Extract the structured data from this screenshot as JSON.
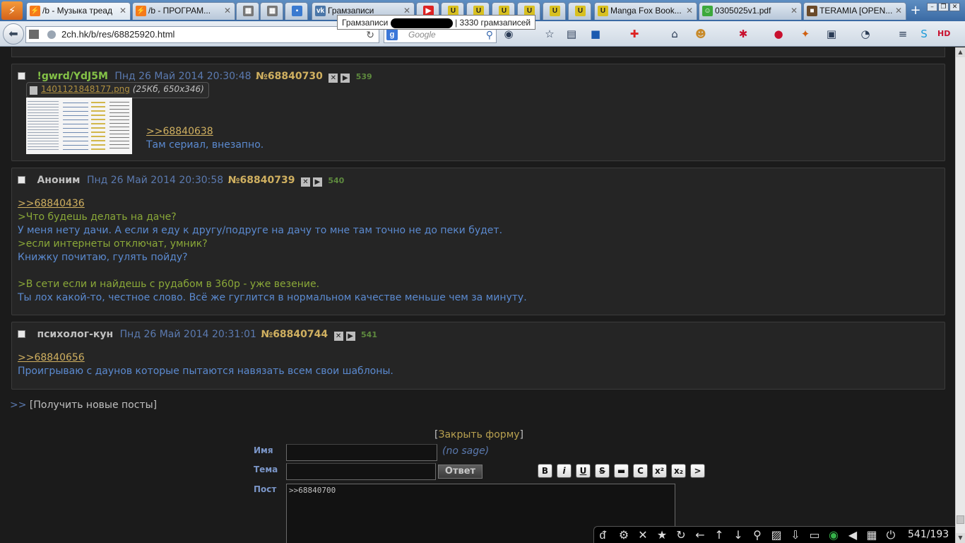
{
  "browser": {
    "tabs": [
      {
        "label": "/b - Музыка треад",
        "icon": "2ch-flame-icon",
        "icon_color": "#f57a1a"
      },
      {
        "label": "/b - ПРОГРАМ...",
        "icon": "2ch-flame-icon",
        "icon_color": "#f57a1a"
      },
      {
        "label": "",
        "icon": "page-icon",
        "icon_color": "#777777"
      },
      {
        "label": "",
        "icon": "page-icon",
        "icon_color": "#777777"
      },
      {
        "label": "",
        "icon": "chat-icon",
        "icon_color": "#3a7ad0"
      },
      {
        "label": "Грамзаписи",
        "icon": "vk-icon",
        "icon_color": "#4a76a8"
      },
      {
        "label": "",
        "icon": "youtube-icon",
        "icon_color": "#d22"
      },
      {
        "label": "",
        "icon": "u-icon",
        "icon_color": "#d8c020"
      },
      {
        "label": "",
        "icon": "u-icon",
        "icon_color": "#d8c020"
      },
      {
        "label": "",
        "icon": "u-icon",
        "icon_color": "#d8c020"
      },
      {
        "label": "",
        "icon": "u-icon",
        "icon_color": "#d8c020"
      },
      {
        "label": "",
        "icon": "u-icon",
        "icon_color": "#d8c020"
      },
      {
        "label": "Manga Fox Book...",
        "icon": "u-icon",
        "icon_color": "#d8c020"
      },
      {
        "label": "0305025v1.pdf",
        "icon": "smiley-icon",
        "icon_color": "#3ca83c"
      },
      {
        "label": "TERAMIA [OPEN...",
        "icon": "cube-icon",
        "icon_color": "#6a4a2a"
      }
    ],
    "tooltip": {
      "prefix": "Грамзаписи",
      "suffix": "| 3330 грамзаписей"
    },
    "url": "2ch.hk/b/res/68825920.html",
    "search_placeholder": "Google"
  },
  "posts": [
    {
      "name": "",
      "trip": "!gwrd/YdJ5M",
      "date": "Пнд 26 Май 2014 20:30:48",
      "num": "№68840730",
      "count": "539",
      "file": {
        "name": "1401121848177.png",
        "meta": "(25Кб, 650x346)"
      },
      "reply": ">>68840638",
      "lines": [
        "Там сериал, внезапно."
      ]
    },
    {
      "name": "Аноним",
      "date": "Пнд 26 Май 2014 20:30:58",
      "num": "№68840739",
      "count": "540",
      "reply": ">>68840436",
      "lines": [
        ">Что будешь делать на даче?",
        "У меня нету дачи. А если я еду к другу/подруге на дачу то мне там точно не до пеки будет.",
        ">если интернеты отключат, умник?",
        "Книжку почитаю, гулять пойду?",
        ">В сети если и найдешь с рудабом в 360р - уже везение.",
        "Ты лох какой-то, честное слово. Всё же гуглится в нормальном качестве меньше чем за минуту."
      ]
    },
    {
      "name": "психолог-кун",
      "date": "Пнд 26 Май 2014 20:31:01",
      "num": "№68840744",
      "count": "541",
      "reply": ">>68840656",
      "lines": [
        "Проигрываю с даунов которые пытаются навязать всем свои шаблоны."
      ]
    }
  ],
  "thread": {
    "get_new_arrow": ">>",
    "get_new_label": "[Получить новые посты]",
    "close_form": "Закрыть форму"
  },
  "form": {
    "name_label": "Имя",
    "subject_label": "Тема",
    "post_label": "Пост",
    "nosage": "(no sage)",
    "submit": "Ответ",
    "post_text": ">>68840700",
    "markup_buttons": [
      "B",
      "i",
      "U",
      "S",
      "▬",
      "C",
      "x²",
      "x₂",
      ">"
    ]
  },
  "bottom_bar": {
    "counter": "541/193"
  }
}
